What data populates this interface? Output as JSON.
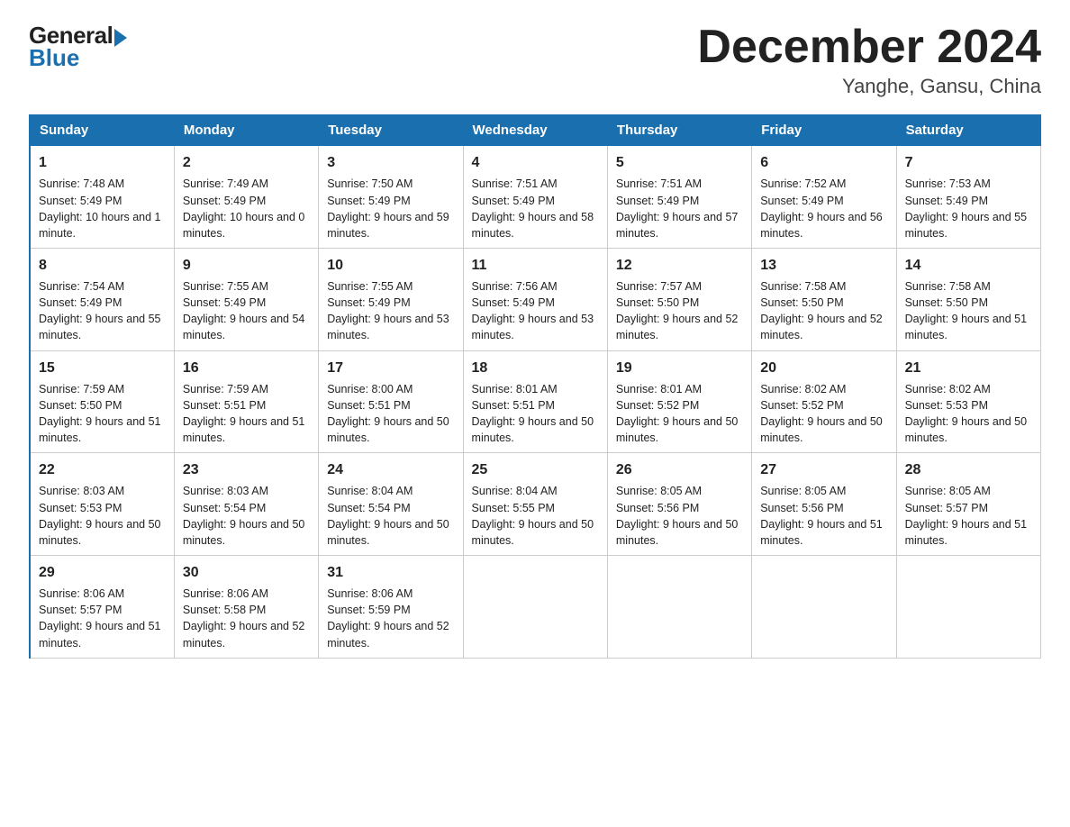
{
  "header": {
    "logo_general": "General",
    "logo_blue": "Blue",
    "month_title": "December 2024",
    "location": "Yanghe, Gansu, China"
  },
  "days_of_week": [
    "Sunday",
    "Monday",
    "Tuesday",
    "Wednesday",
    "Thursday",
    "Friday",
    "Saturday"
  ],
  "weeks": [
    [
      {
        "day": "1",
        "sunrise": "7:48 AM",
        "sunset": "5:49 PM",
        "daylight": "10 hours and 1 minute."
      },
      {
        "day": "2",
        "sunrise": "7:49 AM",
        "sunset": "5:49 PM",
        "daylight": "10 hours and 0 minutes."
      },
      {
        "day": "3",
        "sunrise": "7:50 AM",
        "sunset": "5:49 PM",
        "daylight": "9 hours and 59 minutes."
      },
      {
        "day": "4",
        "sunrise": "7:51 AM",
        "sunset": "5:49 PM",
        "daylight": "9 hours and 58 minutes."
      },
      {
        "day": "5",
        "sunrise": "7:51 AM",
        "sunset": "5:49 PM",
        "daylight": "9 hours and 57 minutes."
      },
      {
        "day": "6",
        "sunrise": "7:52 AM",
        "sunset": "5:49 PM",
        "daylight": "9 hours and 56 minutes."
      },
      {
        "day": "7",
        "sunrise": "7:53 AM",
        "sunset": "5:49 PM",
        "daylight": "9 hours and 55 minutes."
      }
    ],
    [
      {
        "day": "8",
        "sunrise": "7:54 AM",
        "sunset": "5:49 PM",
        "daylight": "9 hours and 55 minutes."
      },
      {
        "day": "9",
        "sunrise": "7:55 AM",
        "sunset": "5:49 PM",
        "daylight": "9 hours and 54 minutes."
      },
      {
        "day": "10",
        "sunrise": "7:55 AM",
        "sunset": "5:49 PM",
        "daylight": "9 hours and 53 minutes."
      },
      {
        "day": "11",
        "sunrise": "7:56 AM",
        "sunset": "5:49 PM",
        "daylight": "9 hours and 53 minutes."
      },
      {
        "day": "12",
        "sunrise": "7:57 AM",
        "sunset": "5:50 PM",
        "daylight": "9 hours and 52 minutes."
      },
      {
        "day": "13",
        "sunrise": "7:58 AM",
        "sunset": "5:50 PM",
        "daylight": "9 hours and 52 minutes."
      },
      {
        "day": "14",
        "sunrise": "7:58 AM",
        "sunset": "5:50 PM",
        "daylight": "9 hours and 51 minutes."
      }
    ],
    [
      {
        "day": "15",
        "sunrise": "7:59 AM",
        "sunset": "5:50 PM",
        "daylight": "9 hours and 51 minutes."
      },
      {
        "day": "16",
        "sunrise": "7:59 AM",
        "sunset": "5:51 PM",
        "daylight": "9 hours and 51 minutes."
      },
      {
        "day": "17",
        "sunrise": "8:00 AM",
        "sunset": "5:51 PM",
        "daylight": "9 hours and 50 minutes."
      },
      {
        "day": "18",
        "sunrise": "8:01 AM",
        "sunset": "5:51 PM",
        "daylight": "9 hours and 50 minutes."
      },
      {
        "day": "19",
        "sunrise": "8:01 AM",
        "sunset": "5:52 PM",
        "daylight": "9 hours and 50 minutes."
      },
      {
        "day": "20",
        "sunrise": "8:02 AM",
        "sunset": "5:52 PM",
        "daylight": "9 hours and 50 minutes."
      },
      {
        "day": "21",
        "sunrise": "8:02 AM",
        "sunset": "5:53 PM",
        "daylight": "9 hours and 50 minutes."
      }
    ],
    [
      {
        "day": "22",
        "sunrise": "8:03 AM",
        "sunset": "5:53 PM",
        "daylight": "9 hours and 50 minutes."
      },
      {
        "day": "23",
        "sunrise": "8:03 AM",
        "sunset": "5:54 PM",
        "daylight": "9 hours and 50 minutes."
      },
      {
        "day": "24",
        "sunrise": "8:04 AM",
        "sunset": "5:54 PM",
        "daylight": "9 hours and 50 minutes."
      },
      {
        "day": "25",
        "sunrise": "8:04 AM",
        "sunset": "5:55 PM",
        "daylight": "9 hours and 50 minutes."
      },
      {
        "day": "26",
        "sunrise": "8:05 AM",
        "sunset": "5:56 PM",
        "daylight": "9 hours and 50 minutes."
      },
      {
        "day": "27",
        "sunrise": "8:05 AM",
        "sunset": "5:56 PM",
        "daylight": "9 hours and 51 minutes."
      },
      {
        "day": "28",
        "sunrise": "8:05 AM",
        "sunset": "5:57 PM",
        "daylight": "9 hours and 51 minutes."
      }
    ],
    [
      {
        "day": "29",
        "sunrise": "8:06 AM",
        "sunset": "5:57 PM",
        "daylight": "9 hours and 51 minutes."
      },
      {
        "day": "30",
        "sunrise": "8:06 AM",
        "sunset": "5:58 PM",
        "daylight": "9 hours and 52 minutes."
      },
      {
        "day": "31",
        "sunrise": "8:06 AM",
        "sunset": "5:59 PM",
        "daylight": "9 hours and 52 minutes."
      },
      null,
      null,
      null,
      null
    ]
  ],
  "labels": {
    "sunrise_prefix": "Sunrise: ",
    "sunset_prefix": "Sunset: ",
    "daylight_prefix": "Daylight: "
  }
}
